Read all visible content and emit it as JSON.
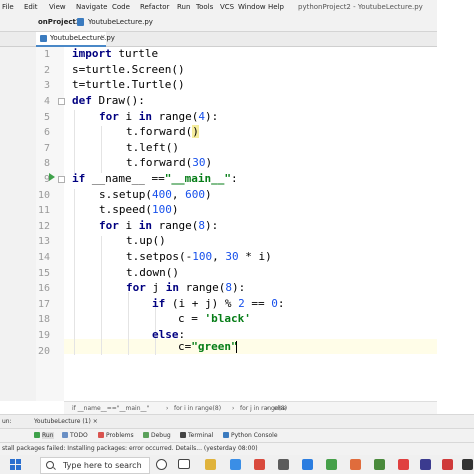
{
  "menu": [
    "File",
    "Edit",
    "View",
    "Navigate",
    "Code",
    "Refactor",
    "Run",
    "Tools",
    "VCS",
    "Window",
    "Help"
  ],
  "window_title": "pythonProject2 - YoutubeLecture.py",
  "breadcrumb": {
    "project": "onProject2",
    "file": "YoutubeLecture.py"
  },
  "editor_tab": {
    "label": "YoutubeLecture.py",
    "close": "×"
  },
  "line_numbers": [
    "1",
    "2",
    "3",
    "4",
    "5",
    "6",
    "7",
    "8",
    "9",
    "10",
    "11",
    "12",
    "13",
    "14",
    "15",
    "16",
    "17",
    "18",
    "19",
    "20"
  ],
  "code": {
    "l1_kw": "import",
    "l1_rest": " turtle",
    "l2": "s=turtle.Screen()",
    "l3": "t=turtle.Turtle()",
    "l4_kw": "def",
    "l4_rest": " Draw():",
    "l5_kw1": "for",
    "l5_var": " i ",
    "l5_kw2": "in",
    "l5_a": " range(",
    "l5_num": "4",
    "l5_b": "):",
    "l6_a": "t.forward(",
    "l6_b": ")",
    "l7": "t.left()",
    "l8_a": "t.forward(",
    "l8_num": "30",
    "l8_b": ")",
    "l9_kw": "if",
    "l9_a": " __name__ ==",
    "l9_str": "\"__main__\"",
    "l9_b": ":",
    "l10_a": "s.setup(",
    "l10_num1": "400",
    "l10_c": ", ",
    "l10_num2": "600",
    "l10_b": ")",
    "l11_a": "t.speed(",
    "l11_num": "100",
    "l11_b": ")",
    "l12_kw1": "for",
    "l12_var": " i ",
    "l12_kw2": "in",
    "l12_a": " range(",
    "l12_num": "8",
    "l12_b": "):",
    "l13": "t.up()",
    "l14_a": "t.setpos(-",
    "l14_num1": "100",
    "l14_c": ", ",
    "l14_num2": "30",
    "l14_d": " * i)",
    "l15": "t.down()",
    "l16_kw1": "for",
    "l16_var": " j ",
    "l16_kw2": "in",
    "l16_a": " range(",
    "l16_num": "8",
    "l16_b": "):",
    "l17_kw": "if",
    "l17_a": " (i + j) % ",
    "l17_num1": "2",
    "l17_c": " == ",
    "l17_num2": "0",
    "l17_b": ":",
    "l18_a": "c = ",
    "l18_str": "'black'",
    "l19_kw": "else",
    "l19_b": ":",
    "l20_a": "c=",
    "l20_str": "\"green\""
  },
  "bottom_breadcrumb": [
    "if __name__==\"__main__\"",
    "for i in range(8)",
    "for j in range(8)",
    "else"
  ],
  "run_panel": {
    "label": "un:",
    "tab": "YoutubeLecture (1) ×"
  },
  "tool_windows": [
    "Run",
    "TODO",
    "Problems",
    "Debug",
    "Terminal",
    "Python Console"
  ],
  "status": "stall packages failed: Installing packages: error occurred. Details... (yesterday 08:00)",
  "taskbar": {
    "search_placeholder": "Type here to search"
  },
  "colors": {
    "keyword": "#000080",
    "string": "#067d17",
    "number": "#1750eb",
    "accent": "#4a88c7"
  }
}
